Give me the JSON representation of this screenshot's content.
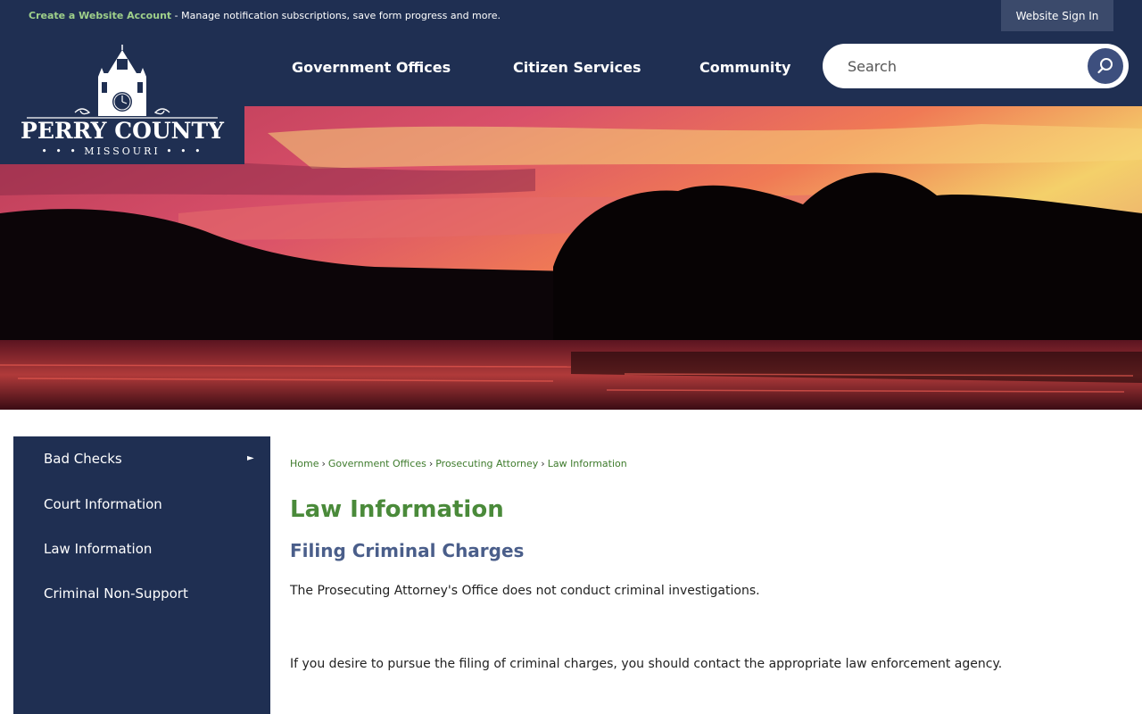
{
  "topbar": {
    "account_link": "Create a Website Account",
    "account_text": " - Manage notification subscriptions, save form progress and more.",
    "signin": "Website Sign In"
  },
  "logo": {
    "name": "PERRY COUNTY",
    "state": "• • • MISSOURI • • •"
  },
  "nav": {
    "items": [
      "Government Offices",
      "Citizen Services",
      "Community"
    ]
  },
  "search": {
    "placeholder": "Search",
    "icon": "search-icon"
  },
  "hero": {
    "description_icon": "sunset-lake-photo"
  },
  "sidebar": {
    "items": [
      "Bad Checks",
      "Court Information",
      "Law Information",
      "Criminal Non-Support"
    ],
    "arrow": "►"
  },
  "breadcrumb": {
    "items": [
      "Home",
      "Government Offices",
      "Prosecuting Attorney",
      "Law Information"
    ],
    "separator": "›"
  },
  "content": {
    "title": "Law Information",
    "subheading": "Filing Criminal Charges",
    "paragraphs": [
      "The Prosecuting Attorney's Office does not conduct criminal investigations.",
      "If you desire to pursue the filing of criminal charges, you should contact the appropriate law enforcement agency."
    ]
  },
  "colors": {
    "navy": "#1f2f52",
    "green_title": "#4a8a3a",
    "link_green": "#3e7b2c",
    "subhead_blue": "#4a5e8a",
    "account_green": "#9fd08a"
  }
}
